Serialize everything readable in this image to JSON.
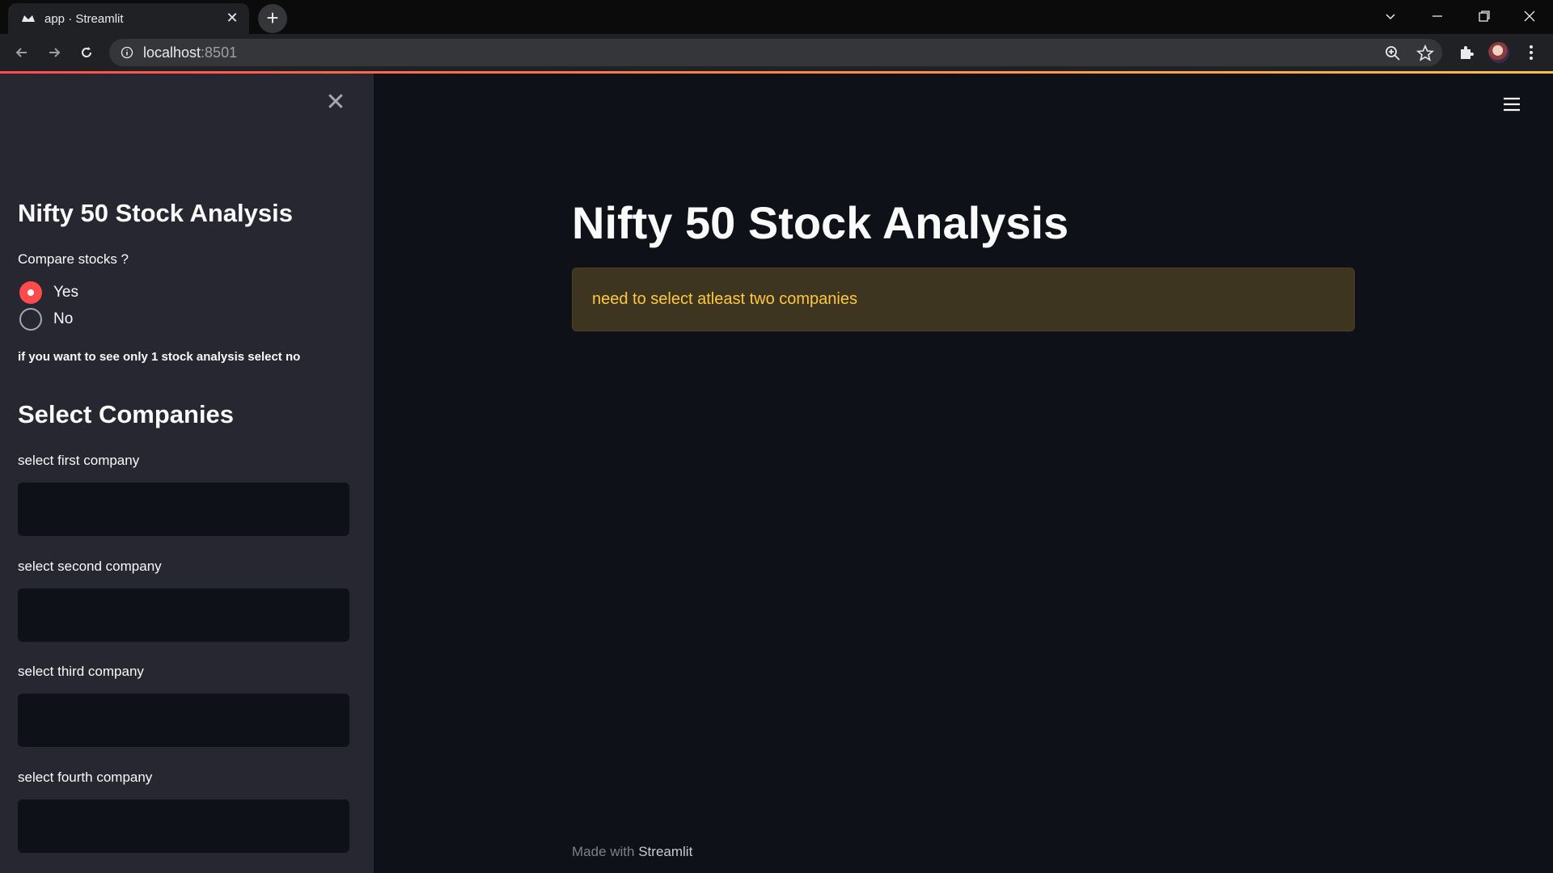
{
  "browser": {
    "tab_title": "app · Streamlit",
    "url_host": "localhost",
    "url_port": ":8501"
  },
  "sidebar": {
    "title": "Nifty 50 Stock Analysis",
    "compare_label": "Compare stocks ?",
    "radio_options": [
      {
        "label": "Yes",
        "selected": true
      },
      {
        "label": "No",
        "selected": false
      }
    ],
    "hint": "if you want to see only 1 stock analysis select no",
    "section_title": "Select Companies",
    "selects": [
      {
        "label": "select first company",
        "value": ""
      },
      {
        "label": "select second company",
        "value": ""
      },
      {
        "label": "select third company",
        "value": ""
      },
      {
        "label": "select fourth company",
        "value": ""
      }
    ]
  },
  "main": {
    "title": "Nifty 50 Stock Analysis",
    "warning": "need to select atleast two companies"
  },
  "footer": {
    "made_with": "Made with",
    "brand": "Streamlit"
  },
  "colors": {
    "accent": "#ff4b4b",
    "warning_text": "#ffc83d",
    "background": "#0e1117",
    "sidebar": "#262730"
  }
}
